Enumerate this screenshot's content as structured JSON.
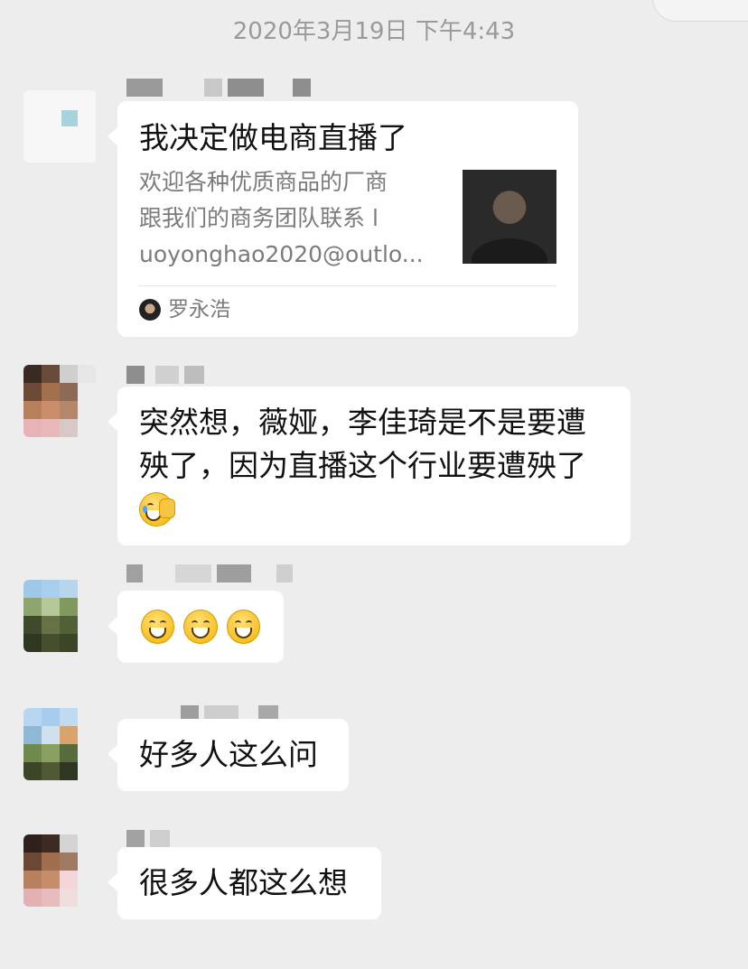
{
  "header": {
    "timestamp": "2020年3月19日 下午4:43"
  },
  "messages": [
    {
      "type": "link-card",
      "card": {
        "title": "我决定做电商直播了",
        "desc_lines": [
          "欢迎各种优质商品的厂商",
          "跟我们的商务团队联系 l",
          "uoyonghao2020@outlo..."
        ],
        "source_name": "罗永浩"
      }
    },
    {
      "type": "text",
      "lines": [
        "突然想，薇娅，李佳琦是不是要遭",
        "殃了，因为直播这个行业要遭殃了"
      ],
      "emoji": "facepalm-emoji"
    },
    {
      "type": "emoji",
      "emoji_count": 3,
      "emoji": "grinning-face-emoji"
    },
    {
      "type": "text",
      "lines": [
        "好多人这么问"
      ]
    },
    {
      "type": "text",
      "lines": [
        "很多人都这么想"
      ]
    }
  ],
  "colors": {
    "background": "#ededed",
    "bubble": "#ffffff",
    "timestamp": "#9a9a9a",
    "secondary_text": "#7b7b7b"
  }
}
